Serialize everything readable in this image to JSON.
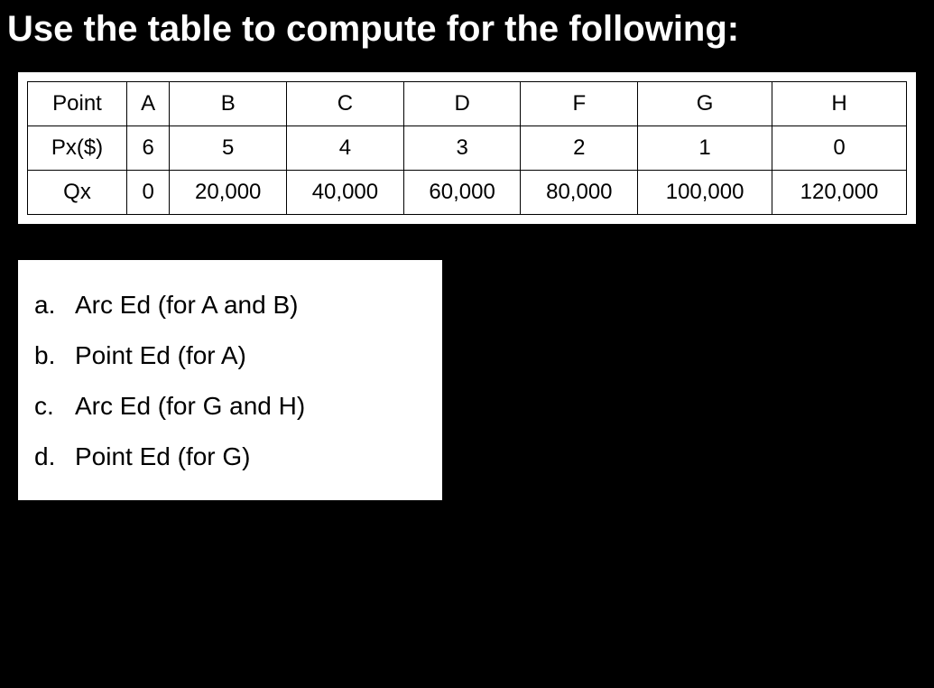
{
  "title": "Use the table to compute for the following:",
  "chart_data": {
    "type": "table",
    "rows": [
      {
        "label": "Point",
        "cells": [
          "A",
          "B",
          "C",
          "D",
          "F",
          "G",
          "H"
        ]
      },
      {
        "label": "Px($)",
        "cells": [
          "6",
          "5",
          "4",
          "3",
          "2",
          "1",
          "0"
        ]
      },
      {
        "label": "Qx",
        "cells": [
          "0",
          "20,000",
          "40,000",
          "60,000",
          "80,000",
          "100,000",
          "120,000"
        ]
      }
    ]
  },
  "questions": [
    {
      "marker": "a.",
      "text": "Arc Ed (for A and B)"
    },
    {
      "marker": "b.",
      "text": "Point Ed (for A)"
    },
    {
      "marker": "c.",
      "text": "Arc Ed (for G and H)"
    },
    {
      "marker": "d.",
      "text": "Point Ed  (for G)"
    }
  ]
}
